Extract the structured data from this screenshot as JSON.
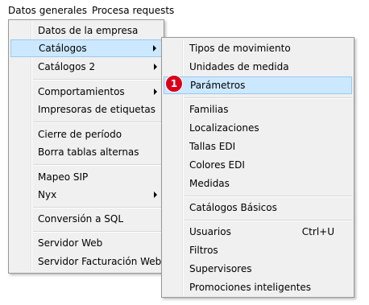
{
  "menubar": {
    "items": [
      "Datos generales",
      "Procesa requests"
    ]
  },
  "main_menu": {
    "items": [
      "Datos de la empresa",
      "Catálogos",
      "Catálogos 2",
      "Comportamientos",
      "Impresoras de etiquetas",
      "Cierre de período",
      "Borra tablas alternas",
      "Mapeo SIP",
      "Nyx",
      "Conversión a SQL",
      "Servidor Web",
      "Servidor Facturación Web"
    ]
  },
  "sub_menu": {
    "items": [
      "Tipos de movimiento",
      "Unidades de medida",
      "Parámetros",
      "Familias",
      "Localizaciones",
      "Tallas EDI",
      "Colores EDI",
      "Medidas",
      "Catálogos Básicos",
      "Usuarios",
      "Filtros",
      "Supervisores",
      "Promociones inteligentes"
    ],
    "usuarios_shortcut": "Ctrl+U"
  },
  "callout": {
    "number": "1",
    "color": "#d9001b"
  },
  "colors": {
    "menu_background": "#f0f0f0",
    "highlight_fill": "#cce8ff",
    "highlight_border": "#99c9ef"
  }
}
